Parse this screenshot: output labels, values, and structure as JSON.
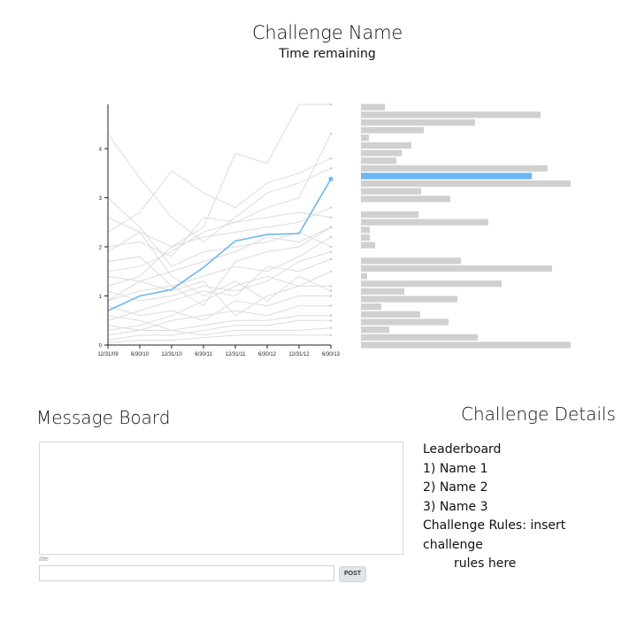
{
  "header": {
    "title": "Challenge Name",
    "subtitle": "Time remaining"
  },
  "chart_data": [
    {
      "type": "line",
      "x": [
        "12/31/09",
        "6/30/10",
        "12/31/10",
        "6/30/11",
        "12/31/11",
        "6/30/12",
        "12/31/12",
        "6/30/13"
      ],
      "ylim": [
        0,
        4.9
      ],
      "yticks": [
        "0",
        "1",
        "2",
        "3",
        "4"
      ],
      "highlight_color": "#6bb6f4",
      "background_color": "#dcdcdc",
      "series": [
        {
          "highlighted": true,
          "values": [
            0.7,
            1.0,
            1.13,
            1.58,
            2.12,
            2.25,
            2.27,
            3.38
          ]
        },
        {
          "values": [
            4.3,
            3.4,
            2.6,
            2.1,
            2.6,
            3.1,
            3.3,
            3.6
          ]
        },
        {
          "values": [
            2.3,
            2.7,
            3.55,
            3.1,
            2.8,
            3.3,
            3.5,
            3.8
          ]
        },
        {
          "values": [
            1.9,
            2.3,
            2.0,
            2.4,
            3.9,
            3.7,
            4.9,
            4.9
          ]
        },
        {
          "values": [
            1.5,
            1.6,
            1.9,
            2.3,
            2.5,
            2.8,
            3.0,
            4.3
          ]
        },
        {
          "values": [
            1.2,
            1.4,
            2.0,
            2.2,
            2.3,
            2.4,
            2.5,
            2.8
          ]
        },
        {
          "values": [
            2.0,
            2.1,
            1.8,
            2.6,
            2.5,
            2.6,
            2.7,
            2.6
          ]
        },
        {
          "values": [
            0.9,
            1.1,
            1.2,
            0.8,
            1.7,
            1.9,
            2.0,
            2.4
          ]
        },
        {
          "values": [
            1.7,
            1.8,
            1.2,
            1.4,
            1.6,
            1.5,
            1.8,
            2.2
          ]
        },
        {
          "values": [
            1.1,
            0.9,
            1.0,
            1.2,
            1.1,
            1.3,
            1.7,
            1.9
          ]
        },
        {
          "values": [
            0.5,
            0.7,
            0.9,
            1.1,
            1.0,
            1.6,
            1.5,
            1.75
          ]
        },
        {
          "values": [
            0.3,
            0.4,
            0.6,
            0.9,
            1.2,
            1.4,
            1.2,
            1.2
          ]
        },
        {
          "values": [
            0.8,
            0.6,
            0.7,
            0.5,
            0.9,
            0.8,
            1.0,
            1.0
          ]
        },
        {
          "values": [
            0.2,
            0.3,
            0.5,
            0.6,
            0.7,
            0.6,
            0.8,
            0.8
          ]
        },
        {
          "values": [
            0.6,
            0.5,
            0.3,
            0.4,
            0.5,
            0.5,
            0.6,
            0.6
          ]
        },
        {
          "values": [
            0.1,
            0.2,
            0.2,
            0.3,
            0.4,
            0.4,
            0.5,
            0.5
          ]
        },
        {
          "values": [
            0.4,
            0.3,
            0.3,
            0.2,
            0.3,
            0.3,
            0.3,
            0.35
          ]
        },
        {
          "values": [
            0.05,
            0.1,
            0.1,
            0.15,
            0.2,
            0.2,
            0.2,
            0.2
          ]
        },
        {
          "values": [
            2.6,
            2.3,
            1.4,
            1.0,
            1.3,
            0.9,
            1.4,
            1.1
          ]
        },
        {
          "values": [
            1.4,
            1.3,
            1.5,
            1.7,
            1.9,
            2.2,
            2.1,
            2.4
          ]
        },
        {
          "values": [
            3.0,
            2.4,
            1.6,
            1.9,
            2.0,
            2.1,
            2.3,
            2.0
          ]
        },
        {
          "values": [
            0.9,
            1.3,
            1.1,
            1.3,
            0.6,
            1.0,
            1.2,
            1.5
          ]
        }
      ]
    },
    {
      "type": "bar",
      "orientation": "horizontal",
      "highlight_color": "#6bb6f4",
      "bar_color": "#d0d0d0",
      "groups": [
        [
          {
            "value": 27
          },
          {
            "value": 203
          },
          {
            "value": 129
          },
          {
            "value": 71
          },
          {
            "value": 9
          },
          {
            "value": 57
          },
          {
            "value": 46
          },
          {
            "value": 40
          },
          {
            "value": 211
          },
          {
            "value": 193,
            "highlighted": true
          },
          {
            "value": 237
          },
          {
            "value": 68
          },
          {
            "value": 101
          }
        ],
        [
          {
            "value": 65
          },
          {
            "value": 144
          },
          {
            "value": 10
          },
          {
            "value": 10
          },
          {
            "value": 16
          }
        ],
        [
          {
            "value": 113
          },
          {
            "value": 216
          },
          {
            "value": 7
          },
          {
            "value": 159
          },
          {
            "value": 49
          },
          {
            "value": 109
          },
          {
            "value": 23
          },
          {
            "value": 67
          },
          {
            "value": 99
          },
          {
            "value": 32
          },
          {
            "value": 132
          },
          {
            "value": 237
          }
        ]
      ],
      "max": 237
    }
  ],
  "message_board": {
    "title": "Message Board",
    "input_hint": "title",
    "input_value": "",
    "post_label": "POST"
  },
  "details": {
    "title": "Challenge Details",
    "leaderboard_heading": "Leaderboard",
    "entries": [
      "1) Name 1",
      "2) Name 2",
      "3) Name 3"
    ],
    "rules_line1": "Challenge Rules: insert challenge",
    "rules_line2": "rules here"
  }
}
